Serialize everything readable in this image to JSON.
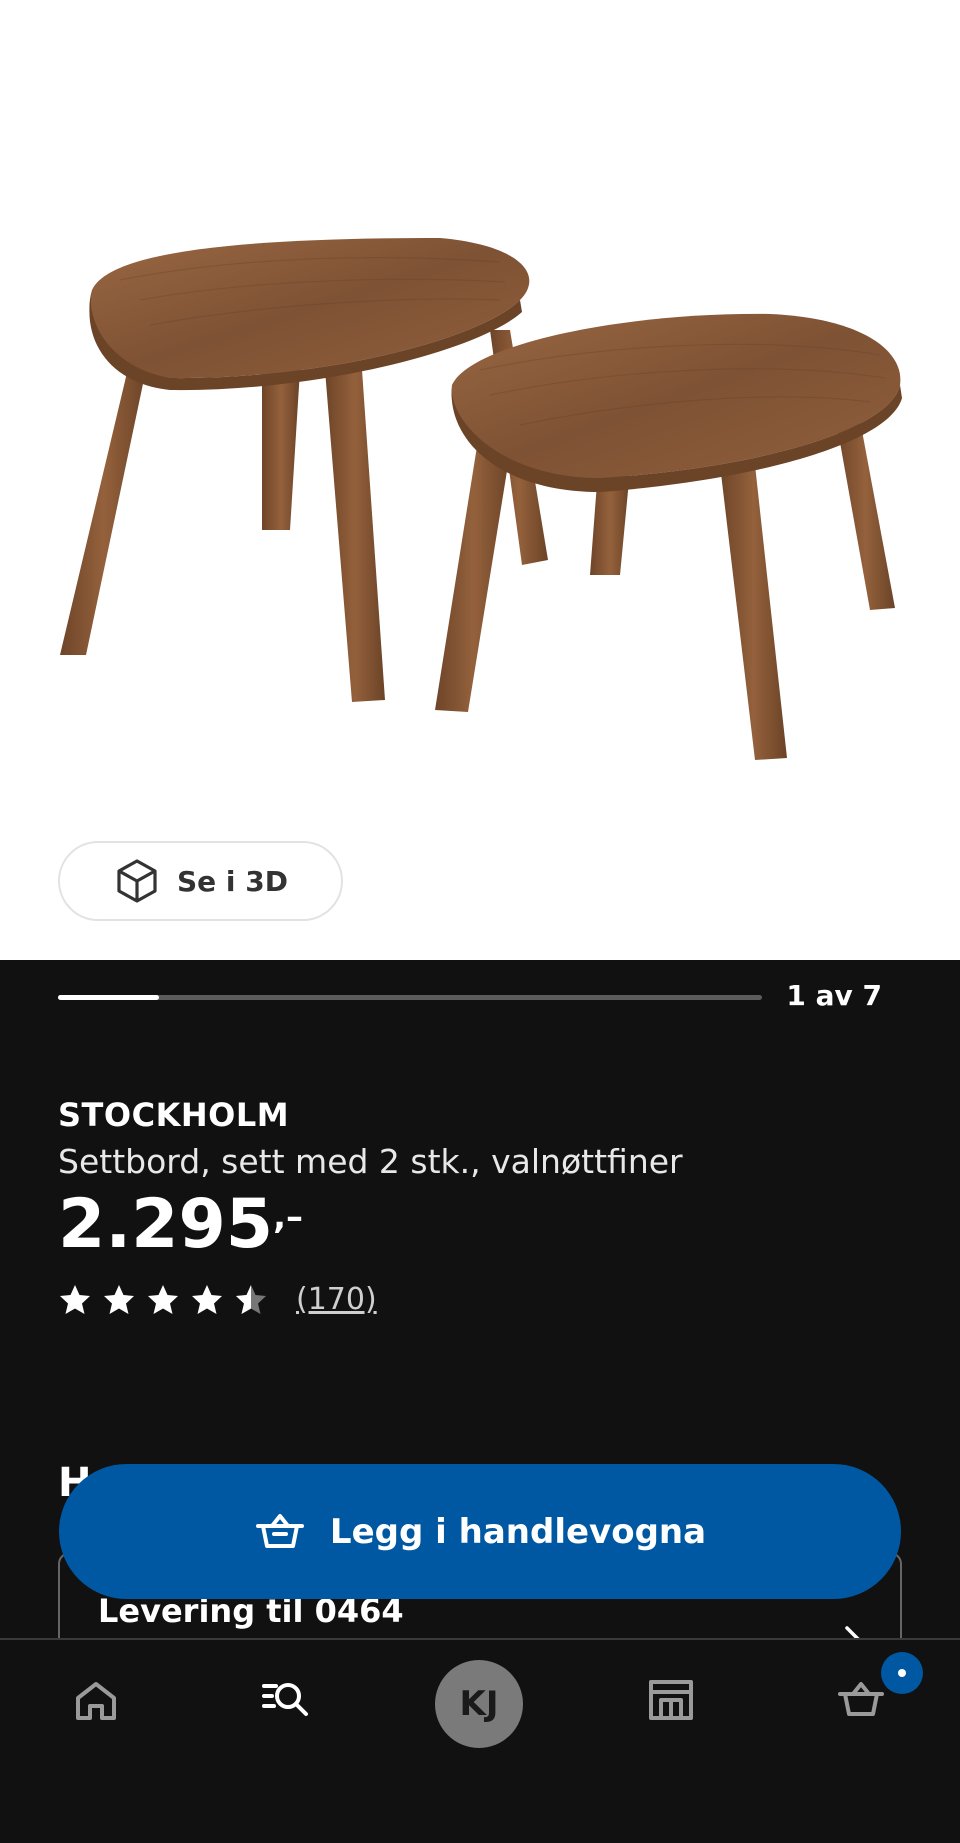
{
  "hero": {
    "image_alt": "product-photo",
    "view_3d_label": "Se i 3D"
  },
  "gallery": {
    "current": 1,
    "total": 7,
    "counter_text": "1 av 7",
    "progress_fraction": 0.143
  },
  "product": {
    "brand": "STOCKHOLM",
    "description": "Settbord, sett med 2 stk., valnøttfiner",
    "price": "2.295",
    "price_suffix": ",–",
    "rating": 4.5,
    "rating_max": 5,
    "review_count_text": "(170)"
  },
  "section": {
    "heading_visible_fragment": "H"
  },
  "delivery": {
    "label": "Levering til 0464"
  },
  "cta": {
    "label": "Legg i handlevogna"
  },
  "bottom_nav": {
    "items": [
      {
        "name": "home",
        "icon": "home-icon"
      },
      {
        "name": "search",
        "icon": "search-list-icon"
      },
      {
        "name": "profile",
        "initials": "KJ"
      },
      {
        "name": "stores",
        "icon": "store-icon"
      },
      {
        "name": "cart",
        "icon": "basket-icon"
      }
    ]
  },
  "colors": {
    "accent": "#0058a3",
    "background_dark": "#111111",
    "hero_background": "#ffffff"
  }
}
